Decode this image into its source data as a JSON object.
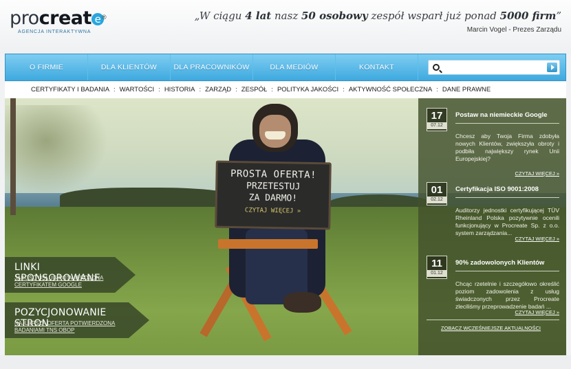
{
  "header": {
    "logo": {
      "pro": "pro",
      "create": "creat",
      "e": "e",
      "reg": "®",
      "tagline": "AGENCJA INTERAKTYWNA"
    },
    "quote": {
      "p1": "„W ciągu ",
      "b1": "4 lat",
      "p2": " nasz ",
      "b2": "50 osobowy",
      "p3": " zespół wsparł już ponad ",
      "b3": "5000 firm",
      "p4": "”",
      "author": "Marcin Vogel - Prezes Zarządu"
    }
  },
  "nav": {
    "items": [
      "O FIRMIE",
      "DLA KLIENTÓW",
      "DLA PRACOWNIKÓW",
      "DLA MEDIÓW",
      "KONTAKT"
    ],
    "search_placeholder": ""
  },
  "subnav": {
    "items": [
      "CERTYFIKATY I BADANIA",
      "WARTOŚCI",
      "HISTORIA",
      "ZARZĄD",
      "ZESPÓŁ",
      "POLITYKA JAKOŚCI",
      "AKTYWNOŚĆ SPOŁECZNA",
      "DANE PRAWNE"
    ],
    "separator": ":"
  },
  "hero": {
    "sign": {
      "line1": "PROSTA OFERTA!",
      "line2": "PRZETESTUJ",
      "line3": "ZA DARMO!",
      "link": "CZYTAJ WIĘCEJ »"
    },
    "banners": [
      {
        "title": "LINKI SPONSOROWANE",
        "sub1": "JAKOŚĆ USŁUG POTWIERDZONA",
        "sub2": "CERTYFIKATEM GOOGLE"
      },
      {
        "title": "POZYCJONOWANIE STRON",
        "sub1": "NAJLEPSZA OFERTA POTWIERDZONA",
        "sub2": "BADANIAMI TNS OBOP"
      }
    ]
  },
  "news": {
    "items": [
      {
        "day": "17",
        "month": "07.12",
        "title": "Postaw na niemieckie Google",
        "body": "Chcesz aby Twoja Firma zdobyła nowych Klientów, zwiększyła obroty i podbiła największy rynek Unii Europejskiej?",
        "more": "CZYTAJ WIĘCEJ »"
      },
      {
        "day": "01",
        "month": "02.12",
        "title": "Certyfikacja ISO 9001:2008",
        "body": "Auditorzy jednostki certyfikującej TÜV Rheinland Polska pozytywnie ocenili funkcjonujący w Procreate Sp. z o.o. system zarządzania...",
        "more": "CZYTAJ WIĘCEJ »"
      },
      {
        "day": "11",
        "month": "01.12",
        "title": "90% zadowolonych Klientów",
        "body": "Chcąc rzetelnie i szczegółowo określić poziom zadowolenia z usług świadczonych przez Procreate zleciliśmy przeprowadzenie badań ...",
        "more": "CZYTAJ WIĘCEJ »"
      }
    ],
    "all": "ZOBACZ WCZEŚNIEJSZE AKTUALNOŚCI"
  }
}
